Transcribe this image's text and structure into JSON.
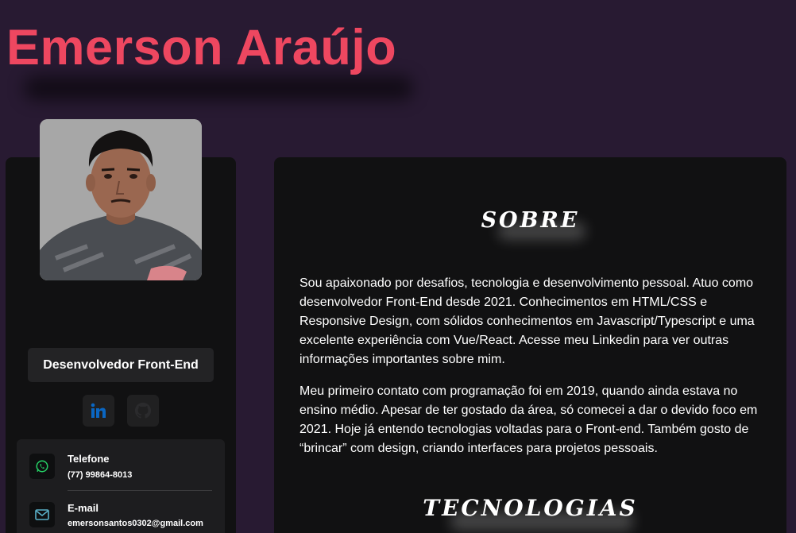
{
  "header": {
    "name": "Emerson Araújo"
  },
  "profile": {
    "avatar_alt": "Foto de Emerson Araújo",
    "role": "Desenvolvedor Front-End",
    "social": [
      {
        "icon": "linkedin-icon",
        "color": "#0a66c2"
      },
      {
        "icon": "github-icon",
        "color": "#2a2a2a"
      }
    ]
  },
  "contacts": [
    {
      "label": "Telefone",
      "value": "(77) 99864-8013",
      "icon": "whatsapp-icon",
      "color": "#25d366"
    },
    {
      "label": "E-mail",
      "value": "emersonsantos0302@gmail.com",
      "icon": "mail-icon",
      "color": "#5ab0c8"
    }
  ],
  "about": {
    "title": "SOBRE",
    "paragraphs": [
      "Sou apaixonado por desafios, tecnologia e desenvolvimento pessoal. Atuo como desenvolvedor Front-End desde 2021. Conhecimentos em HTML/CSS e Responsive Design, com sólidos conhecimentos em Javascript/Typescript e uma excelente experiência com Vue/React. Acesse meu Linkedin para ver outras informações importantes sobre mim.",
      "Meu primeiro contato com programação foi em 2019, quando ainda estava no ensino médio. Apesar de ter gostado da área, só comecei a dar o devido foco em 2021. Hoje já entendo tecnologias voltadas para o Front-end. Também gosto de “brincar” com design, criando interfaces para projetos pessoais."
    ]
  },
  "technologies": {
    "title": "TECNOLOGIAS"
  },
  "theme": {
    "accent": "#ee4760",
    "background": "#281a32",
    "card": "#111112"
  }
}
